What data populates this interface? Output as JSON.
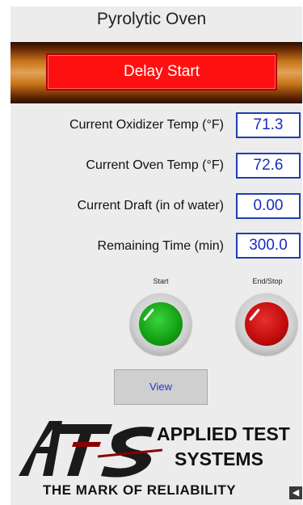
{
  "header": {
    "title": "Pyrolytic Oven"
  },
  "banner": {
    "delay_start_label": "Delay Start"
  },
  "readings": [
    {
      "label": "Current Oxidizer Temp (°F)",
      "value": "71.3"
    },
    {
      "label": "Current Oven Temp (°F)",
      "value": "72.6"
    },
    {
      "label": "Current Draft (in of water)",
      "value": "0.00"
    },
    {
      "label": "Remaining Time (min)",
      "value": "300.0"
    }
  ],
  "controls": {
    "start_label": "Start",
    "stop_label": "End/Stop",
    "view_label": "View"
  },
  "logo": {
    "mark": "ATS",
    "company_line1": "APPLIED TEST",
    "company_line2": "SYSTEMS",
    "tagline": "THE MARK OF RELIABILITY"
  },
  "colors": {
    "delay_button": "#ff1010",
    "value_text": "#1a2cc0",
    "start_knob": "#15a315",
    "stop_knob": "#c40d0d"
  },
  "icons": {
    "corner": "back-arrow-icon"
  }
}
